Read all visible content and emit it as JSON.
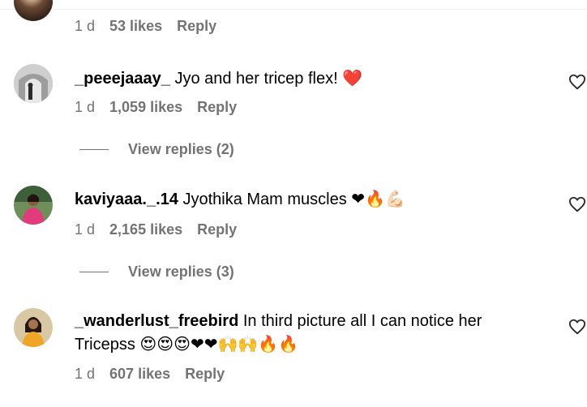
{
  "comments": [
    {
      "time": "1 d",
      "likes": "53 likes",
      "reply": "Reply"
    },
    {
      "username": "_peeejaaay_",
      "text": " Jyo and her tricep flex!",
      "emoji": "❤️",
      "time": "1 d",
      "likes": "1,059 likes",
      "reply": "Reply",
      "view_replies": "View replies (2)"
    },
    {
      "username": "kaviyaaa._.14",
      "text": " Jyothika Mam muscles ",
      "emoji": "❤🔥💪🏻",
      "time": "1 d",
      "likes": "2,165 likes",
      "reply": "Reply",
      "view_replies": "View replies (3)"
    },
    {
      "username": "_wanderlust_freebird",
      "text": " In third picture all I can notice her",
      "text2": "Tricepss ",
      "emoji": "😍😍😍❤❤🙌🙌🔥🔥",
      "time": "1 d",
      "likes": "607 likes",
      "reply": "Reply"
    }
  ]
}
